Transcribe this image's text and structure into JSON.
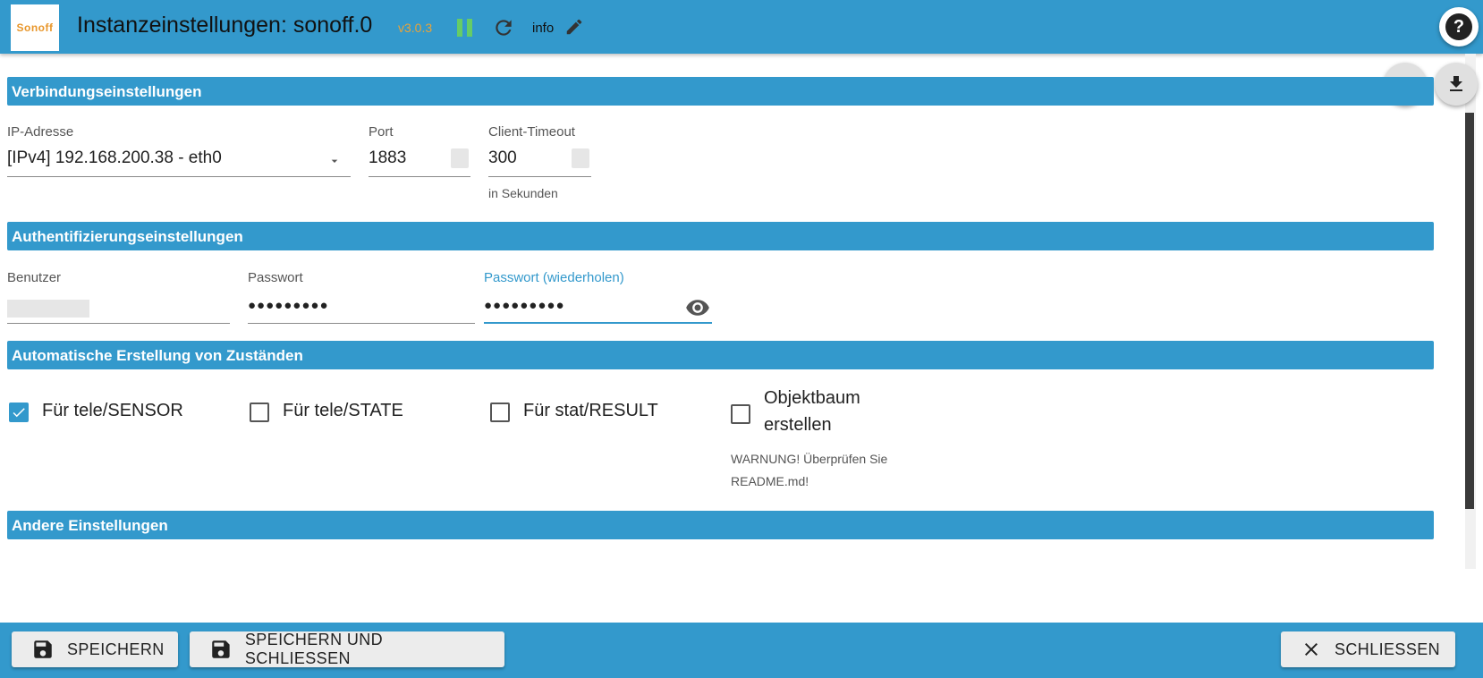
{
  "header": {
    "logo_text": "Sonoff",
    "title": "Instanzeinstellungen: sonoff.0",
    "version": "v3.0.3",
    "info_label": "info",
    "help_glyph": "?",
    "icons": [
      "pause-icon",
      "reload-icon",
      "pencil-icon",
      "help-icon"
    ]
  },
  "toolbar": {
    "icons": [
      "upload-icon",
      "download-icon"
    ]
  },
  "sections": {
    "connection": "Verbindungseinstellungen",
    "auth": "Authentifizierungseinstellungen",
    "auto_states": "Automatische Erstellung von Zuständen",
    "other": "Andere Einstellungen"
  },
  "connection": {
    "ip_label": "IP-Adresse",
    "ip_value": "[IPv4] 192.168.200.38 - eth0",
    "port_label": "Port",
    "port_value": "1883",
    "timeout_label": "Client-Timeout",
    "timeout_value": "300",
    "timeout_helper": "in Sekunden"
  },
  "auth": {
    "user_label": "Benutzer",
    "password_label": "Passwort",
    "password_value": "●●●●●●●●●",
    "password_repeat_label": "Passwort (wiederholen)",
    "password_repeat_value": "●●●●●●●●●"
  },
  "auto_states": {
    "items": [
      {
        "label": "Für tele/SENSOR",
        "checked": true
      },
      {
        "label": "Für tele/STATE",
        "checked": false
      },
      {
        "label": "Für stat/RESULT",
        "checked": false
      },
      {
        "label_line1": "Objektbaum",
        "label_line2": "erstellen",
        "checked": false
      }
    ],
    "warning_line1": "WARNUNG! Überprüfen Sie",
    "warning_line2": "README.md!"
  },
  "footer": {
    "save": "SPEICHERN",
    "save_close": "SPEICHERN UND SCHLIESSEN",
    "close": "SCHLIESSEN"
  },
  "colors": {
    "accent": "#3399cc",
    "version": "#e8a33a",
    "running": "#66cc66"
  }
}
